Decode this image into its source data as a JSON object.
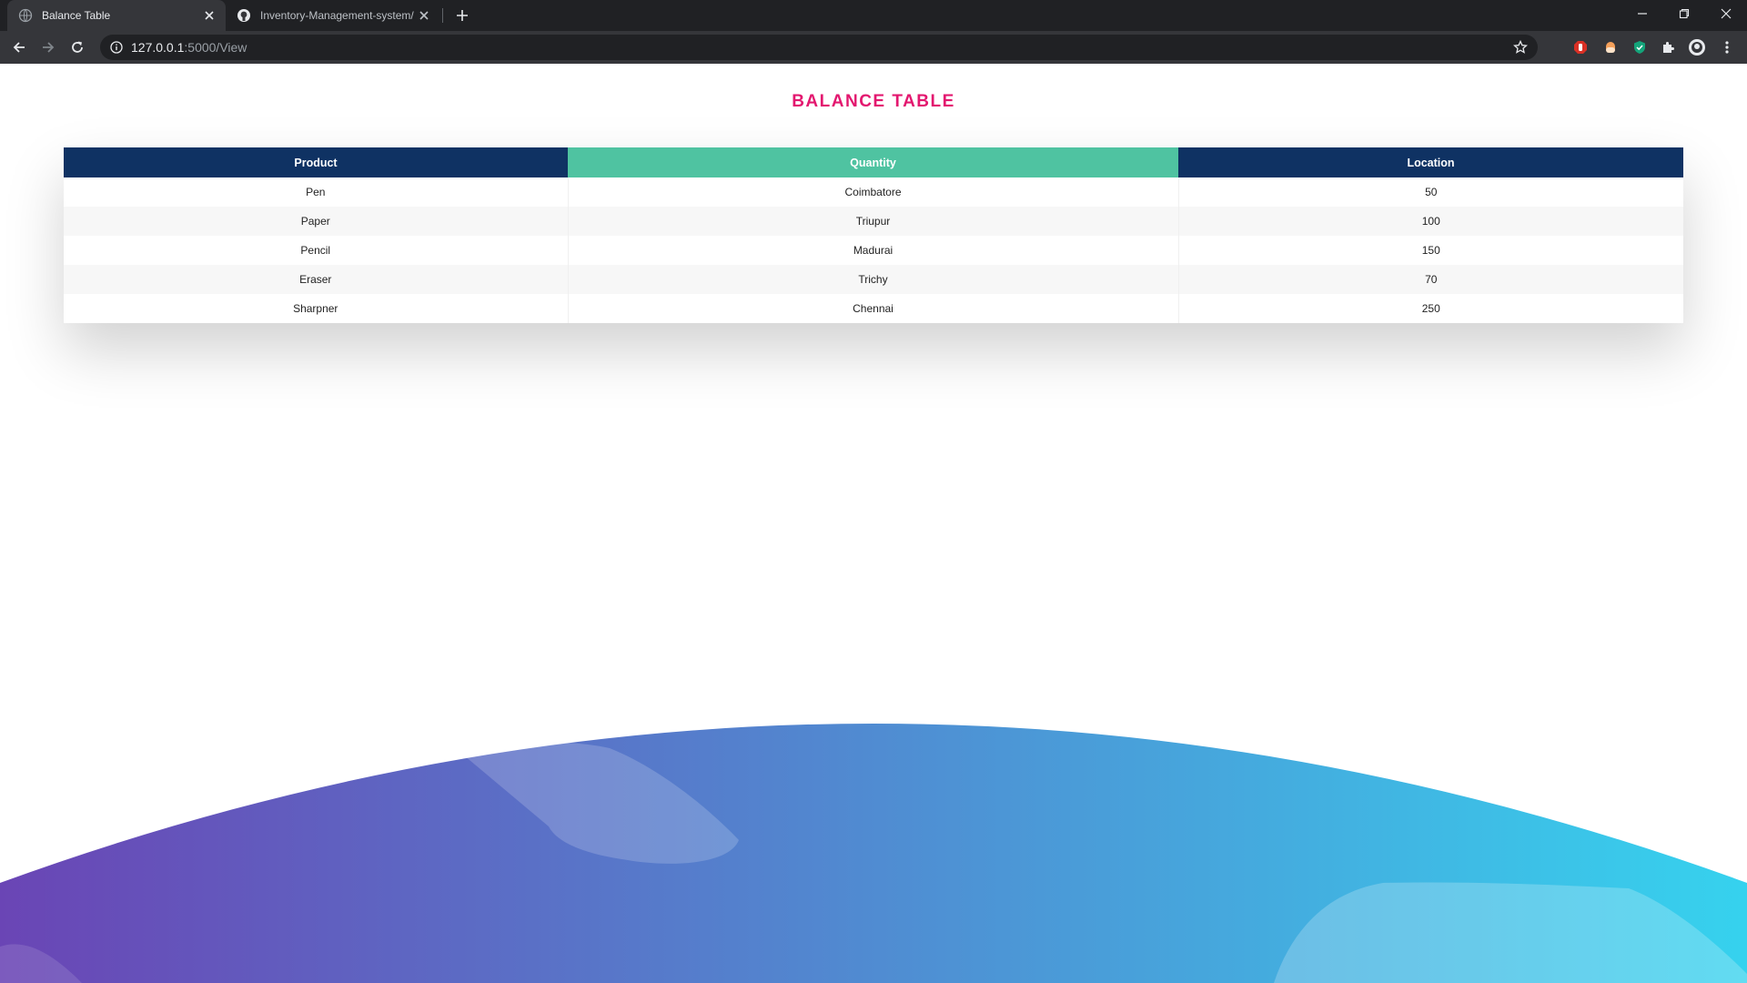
{
  "browser": {
    "tabs": [
      {
        "title": "Balance Table",
        "active": true
      },
      {
        "title": "Inventory-Management-system/",
        "active": false
      }
    ],
    "address": {
      "host": "127.0.0.1",
      "path": ":5000/View"
    }
  },
  "page": {
    "title": "BALANCE TABLE",
    "table": {
      "headers": [
        "Product",
        "Quantity",
        "Location"
      ],
      "rows": [
        [
          "Pen",
          "Coimbatore",
          "50"
        ],
        [
          "Paper",
          "Triupur",
          "100"
        ],
        [
          "Pencil",
          "Madurai",
          "150"
        ],
        [
          "Eraser",
          "Trichy",
          "70"
        ],
        [
          "Sharpner",
          "Chennai",
          "250"
        ]
      ]
    }
  },
  "colors": {
    "title": "#e3176f",
    "header_dark": "#0f3263",
    "header_accent": "#4fc3a1",
    "wave_start": "#6a45b5",
    "wave_end": "#36d2ee"
  }
}
